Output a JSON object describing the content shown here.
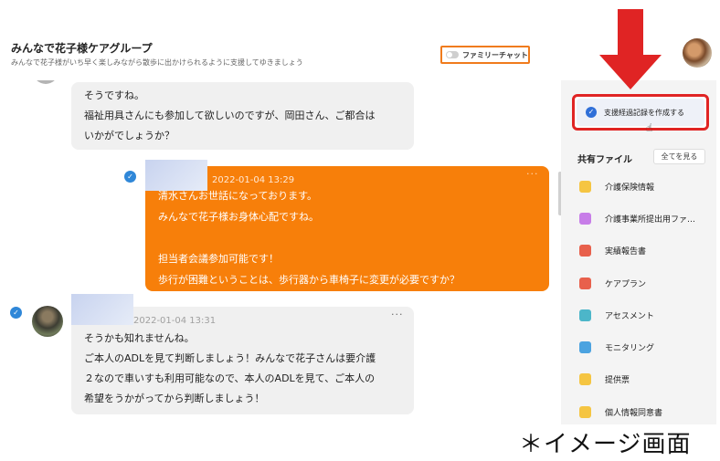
{
  "header": {
    "group_name": "みんなで花子様ケアグループ",
    "group_description": "みんなで花子様がいち早く楽しみながら散歩に出かけられるように支援してゆきましょう",
    "family_chat_label": "ファミリーチャット"
  },
  "chat": {
    "messages": [
      {
        "lines": [
          "そうですね。",
          "福祉用具さんにも参加して欲しいのですが、岡田さん、ご都合は",
          "いかがでしょうか？"
        ]
      },
      {
        "timestamp": "2022-01-04 13:29",
        "more": "···",
        "lines": [
          "清水さんお世話になっております。",
          "みんなで花子様お身体心配ですね。",
          "",
          "担当者会議参加可能です！",
          "歩行が困難ということは、歩行器から車椅子に変更が必要ですか？"
        ]
      },
      {
        "timestamp": "2022-01-04 13:31",
        "more": "···",
        "lines": [
          "そうかも知れませんね。",
          "ご本人のADLを見て判断しましょう！みんなで花子さんは要介護",
          "２なので車いすも利用可能なので、本人のADLを見て、ご本人の",
          "希望をうかがってから判断しましょう！"
        ]
      }
    ]
  },
  "sidebar": {
    "action_button_label": "支援経過記録を作成する",
    "shared_files_title": "共有ファイル",
    "see_all_label": "全てを見る",
    "files": [
      {
        "label": "介護保険情報",
        "icon": "document-icon",
        "color": "#f5c542"
      },
      {
        "label": "介護事業所提出用ファ…",
        "icon": "chart-icon",
        "color": "#c77de8"
      },
      {
        "label": "実績報告書",
        "icon": "report-icon",
        "color": "#e8604c"
      },
      {
        "label": "ケアプラン",
        "icon": "plan-icon",
        "color": "#e8604c"
      },
      {
        "label": "アセスメント",
        "icon": "assessment-icon",
        "color": "#4cb6c9"
      },
      {
        "label": "モニタリング",
        "icon": "monitoring-icon",
        "color": "#4ca3e0"
      },
      {
        "label": "提供票",
        "icon": "sheet-icon",
        "color": "#f5c542"
      },
      {
        "label": "個人情報同意書",
        "icon": "consent-icon",
        "color": "#f5c542"
      }
    ]
  },
  "caption": "＊イメージ画面",
  "colors": {
    "accent_orange": "#f77f0a",
    "highlight_red": "#e02424",
    "check_blue": "#2f87d8"
  }
}
